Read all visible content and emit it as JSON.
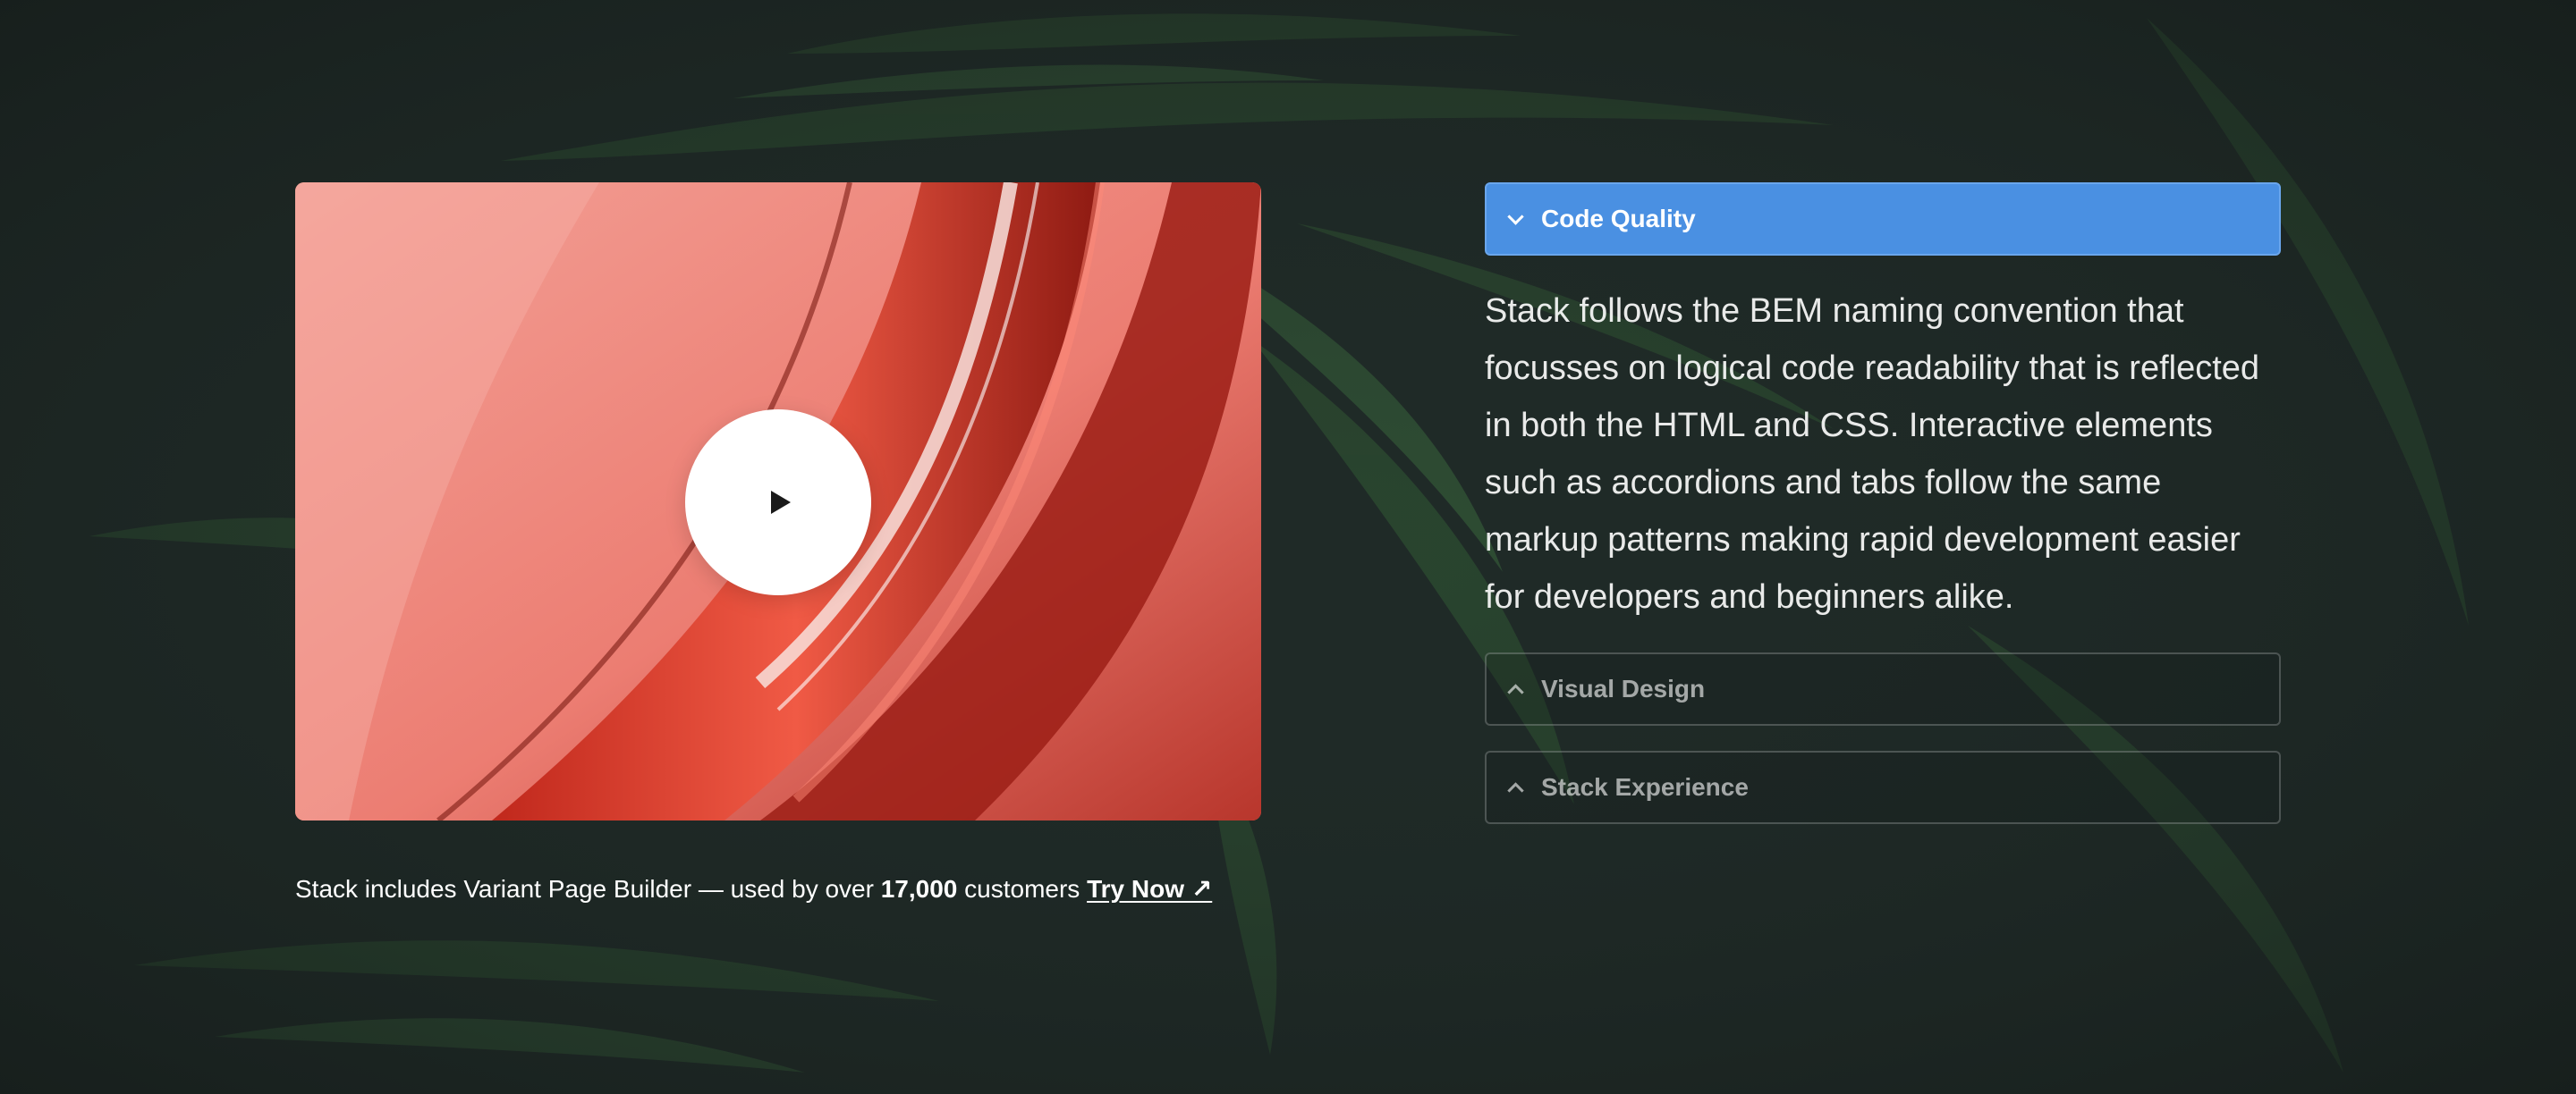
{
  "media": {
    "play_label": "Play video"
  },
  "caption": {
    "prefix": "Stack includes Variant Page Builder — used by over",
    "count": "17,000",
    "suffix": "customers",
    "link_label": "Try Now ↗"
  },
  "accordion": {
    "items": [
      {
        "title": "Code Quality",
        "expanded": true,
        "body": "Stack follows the BEM naming convention that focusses on logical code readability that is reflected in both the HTML and CSS. Interactive elements such as accordions and tabs follow the same markup patterns making rapid development easier for developers and beginners alike."
      },
      {
        "title": "Visual Design",
        "expanded": false
      },
      {
        "title": "Stack Experience",
        "expanded": false
      }
    ]
  },
  "colors": {
    "background": "#1f2a27",
    "accent": "#4a90e2",
    "leaf": "#2f5a34",
    "media_base": "#ea7a70"
  }
}
